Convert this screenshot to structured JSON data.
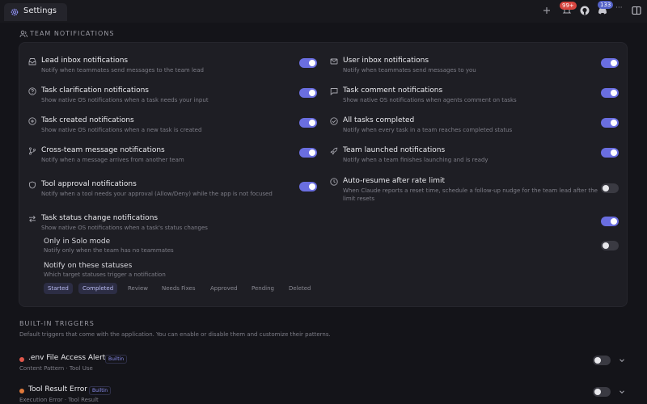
{
  "window": {
    "tab_title": "Settings",
    "notifications_badge": "99+",
    "discord_badge": "133",
    "more_label": "···"
  },
  "section": {
    "title": "TEAM NOTIFICATIONS"
  },
  "left_items": [
    {
      "title": "Lead inbox notifications",
      "desc": "Notify when teammates send messages to the team lead",
      "on": true,
      "icon": "inbox-icon"
    },
    {
      "title": "Task clarification notifications",
      "desc": "Show native OS notifications when a task needs your input",
      "on": true,
      "icon": "question-icon"
    },
    {
      "title": "Task created notifications",
      "desc": "Show native OS notifications when a new task is created",
      "on": true,
      "icon": "plus-circle-icon"
    },
    {
      "title": "Cross-team message notifications",
      "desc": "Notify when a message arrives from another team",
      "on": true,
      "icon": "branch-icon"
    },
    {
      "title": "Tool approval notifications",
      "desc": "Notify when a tool needs your approval (Allow/Deny) while the app is not focused",
      "on": true,
      "icon": "shield-icon"
    },
    {
      "title": "Task status change notifications",
      "desc": "Show native OS notifications when a task's status changes",
      "on": true,
      "icon": "swap-icon"
    }
  ],
  "right_items": [
    {
      "title": "User inbox notifications",
      "desc": "Notify when teammates send messages to you",
      "on": true,
      "icon": "mail-icon"
    },
    {
      "title": "Task comment notifications",
      "desc": "Show native OS notifications when agents comment on tasks",
      "on": true,
      "icon": "comment-icon"
    },
    {
      "title": "All tasks completed",
      "desc": "Notify when every task in a team reaches completed status",
      "on": true,
      "icon": "check-circle-icon"
    },
    {
      "title": "Team launched notifications",
      "desc": "Notify when a team finishes launching and is ready",
      "on": true,
      "icon": "rocket-icon"
    },
    {
      "title": "Auto-resume after rate limit",
      "desc": "When Claude reports a reset time, schedule a follow-up nudge for the team lead after the",
      "desc2": "limit resets",
      "on": false,
      "icon": "clock-icon"
    }
  ],
  "solo": {
    "title": "Only in Solo mode",
    "desc": "Notify only when the team has no teammates",
    "on": false
  },
  "statuses": {
    "title": "Notify on these statuses",
    "desc": "Which target statuses trigger a notification",
    "chips": [
      {
        "label": "Started",
        "selected": true
      },
      {
        "label": "Completed",
        "selected": true
      },
      {
        "label": "Review",
        "selected": false
      },
      {
        "label": "Needs Fixes",
        "selected": false
      },
      {
        "label": "Approved",
        "selected": false
      },
      {
        "label": "Pending",
        "selected": false
      },
      {
        "label": "Deleted",
        "selected": false
      }
    ]
  },
  "builtin": {
    "title": "BUILT-IN TRIGGERS",
    "desc": "Default triggers that come with the application. You can enable or disable them and customize their patterns.",
    "triggers": [
      {
        "name": ".env File Access Alert",
        "badge": "Builtin",
        "meta": "Content Pattern  ·  Tool Use",
        "on": false,
        "color": "#e0574b"
      },
      {
        "name": "Tool Result Error",
        "badge": "Builtin",
        "meta": "Execution Error  ·  Tool Result",
        "on": false,
        "color": "#e07a3b"
      }
    ]
  }
}
